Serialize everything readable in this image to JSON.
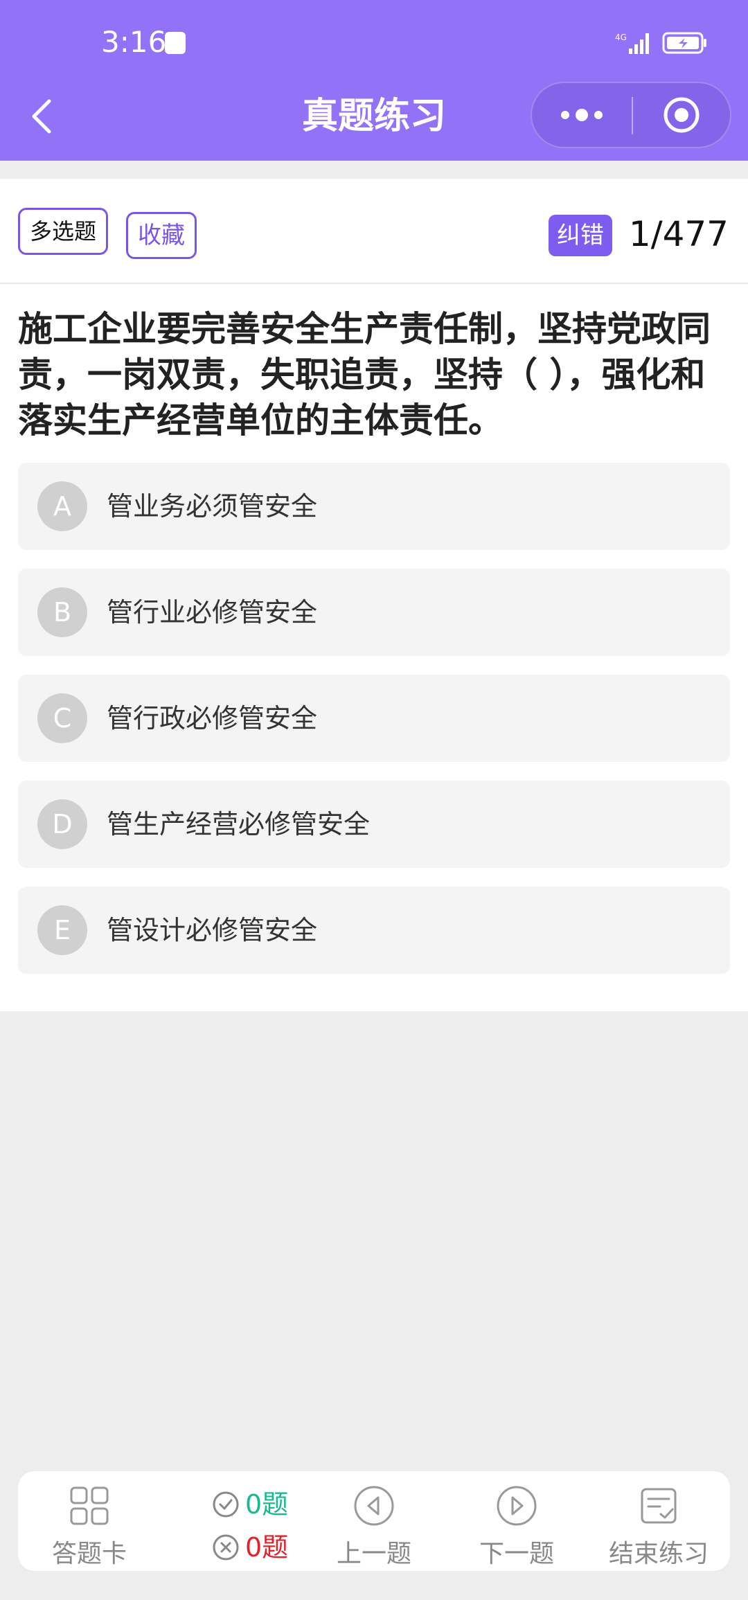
{
  "status_bar": {
    "time": "3:16"
  },
  "nav": {
    "title": "真题练习"
  },
  "tags": {
    "type": "多选题",
    "favorite": "收藏",
    "report_error": "纠错"
  },
  "progress": {
    "counter": "1/477"
  },
  "question": {
    "text": "施工企业要完善安全生产责任制，坚持党政同责，一岗双责，失职追责，坚持（ ），强化和落实生产经营单位的主体责任。"
  },
  "options": [
    {
      "letter": "A",
      "text": "管业务必须管安全"
    },
    {
      "letter": "B",
      "text": "管行业必修管安全"
    },
    {
      "letter": "C",
      "text": "管行政必修管安全"
    },
    {
      "letter": "D",
      "text": "管生产经营必修管安全"
    },
    {
      "letter": "E",
      "text": "管设计必修管安全"
    }
  ],
  "bottom_bar": {
    "answer_card": "答题卡",
    "correct": "0题",
    "wrong": "0题",
    "prev": "上一题",
    "next": "下一题",
    "finish": "结束练习"
  },
  "colors": {
    "accent": "#9272f7",
    "correct": "#19b98e",
    "wrong": "#e0232b"
  }
}
